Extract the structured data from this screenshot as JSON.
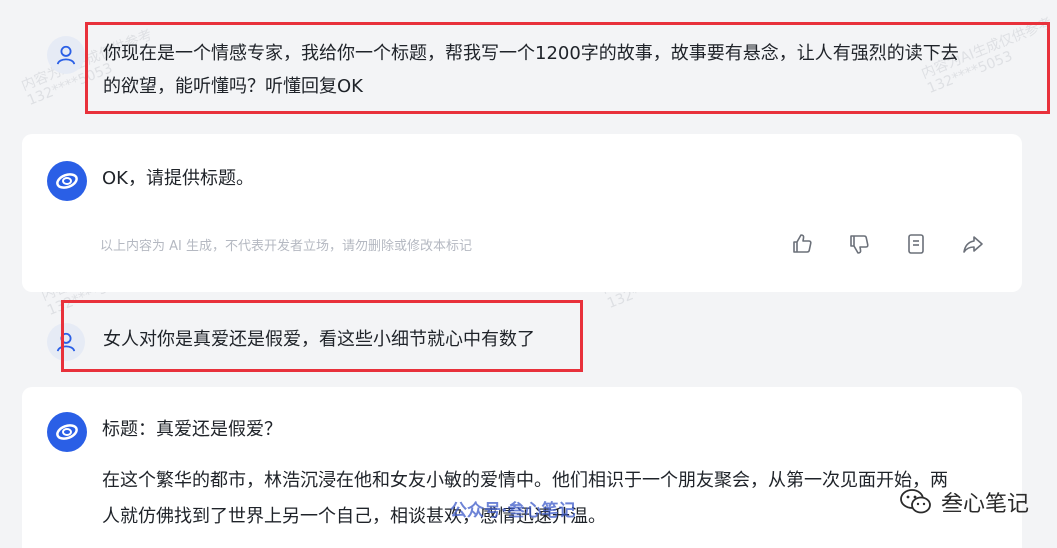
{
  "messages": {
    "user1": {
      "text_line1": "你现在是一个情感专家，我给你一个标题，帮我写一个1200字的故事，故事要有悬念，让人有强烈的读下去",
      "text_line2": "的欲望，能听懂吗？听懂回复OK"
    },
    "ai1": {
      "text": "OK，请提供标题。",
      "disclaimer": "以上内容为 AI 生成，不代表开发者立场，请勿删除或修改本标记"
    },
    "user2": {
      "text": "女人对你是真爱还是假爱，看这些小细节就心中有数了"
    },
    "ai2": {
      "title": "标题：真爱还是假爱？",
      "para_line1": "在这个繁华的都市，林浩沉浸在他和女友小敏的爱情中。他们相识于一个朋友聚会，从第一次见面开始，两",
      "para_line2": "人就仿佛找到了世界上另一个自己，相谈甚欢，感情迅速升温。"
    }
  },
  "watermark": {
    "line1": "内容为AI生成仅供参考",
    "line2": "132****5053"
  },
  "overlay": {
    "text": "公众号·叁心笔记"
  },
  "brand": {
    "name": "叁心笔记"
  },
  "icons": [
    "user-icon",
    "ai-logo-icon",
    "thumbs-up-icon",
    "thumbs-down-icon",
    "copy-icon",
    "share-icon",
    "wechat-icon"
  ],
  "colors": {
    "highlight": "#e8313b",
    "ai_brand": "#2a5fe6",
    "page_bg": "#f3f4f6"
  }
}
